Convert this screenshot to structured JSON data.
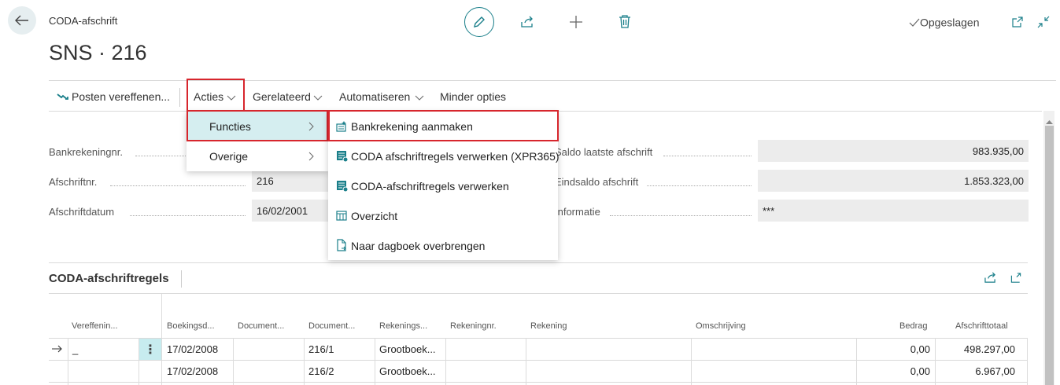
{
  "header": {
    "breadcrumb": "CODA-afschrift",
    "title": "SNS · 216",
    "saved_status": "Opgeslagen"
  },
  "toolbar": {
    "posten": "Posten vereffenen...",
    "acties": "Acties",
    "gerelateerd": "Gerelateerd",
    "automatiseren": "Automatiseren",
    "minder": "Minder opties"
  },
  "acties_menu": {
    "items": [
      "Functies",
      "Overige"
    ]
  },
  "functies_menu": {
    "items": [
      "Bankrekening aanmaken",
      "CODA afschriftregels verwerken (XPR365)",
      "CODA-afschriftregels verwerken",
      "Overzicht",
      "Naar dagboek overbrengen"
    ]
  },
  "form": {
    "bankrekeningnr_label": "Bankrekeningnr.",
    "afschriftnr_label": "Afschriftnr.",
    "afschriftnr_value": "216",
    "afschriftdatum_label": "Afschriftdatum",
    "afschriftdatum_value": "16/02/2001",
    "saldo_laatste_label": "Saldo laatste afschrift",
    "saldo_laatste_value": "983.935,00",
    "eindsaldo_label": "Eindsaldo afschrift",
    "eindsaldo_value": "1.853.323,00",
    "informatie_label": "Informatie",
    "informatie_value": "***"
  },
  "lines": {
    "title": "CODA-afschriftregels",
    "columns": [
      "Vereffenin...",
      "Boekingsd...",
      "Document...",
      "Document...",
      "Rekenings...",
      "Rekeningnr.",
      "Rekening",
      "Omschrijving",
      "Bedrag",
      "Afschrifttotaal"
    ],
    "rows": [
      {
        "vereffening": "_",
        "boekingsdatum": "17/02/2008",
        "document": "216/1",
        "rekeningsoort": "Grootboek...",
        "bedrag": "0,00",
        "totaal": "498.297,00"
      },
      {
        "vereffening": "",
        "boekingsdatum": "17/02/2008",
        "document": "216/2",
        "rekeningsoort": "Grootboek...",
        "bedrag": "0,00",
        "totaal": "6.967,00"
      }
    ]
  }
}
